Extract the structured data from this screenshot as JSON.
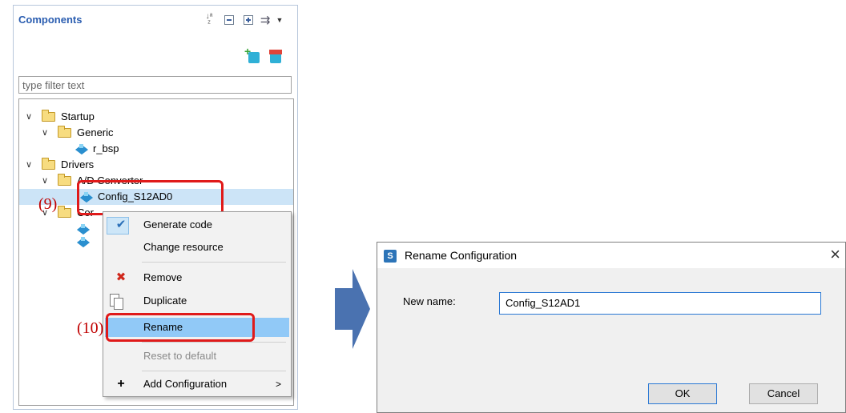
{
  "components": {
    "title": "Components",
    "filter_placeholder": "type filter text",
    "tree": {
      "startup": "Startup",
      "generic": "Generic",
      "r_bsp": "r_bsp",
      "drivers": "Drivers",
      "ad_converter": "A/D Converter",
      "config_s12ad0": "Config_S12AD0",
      "partial_folder": "Cor"
    }
  },
  "context_menu": {
    "items": [
      {
        "label": "Generate code"
      },
      {
        "label": "Change resource"
      },
      {
        "label": "Remove"
      },
      {
        "label": "Duplicate"
      },
      {
        "label": "Rename"
      },
      {
        "label": "Reset to default"
      },
      {
        "label": "Add Configuration"
      }
    ],
    "submenu_arrow": ">"
  },
  "annotations": {
    "step9": "(9)",
    "step10": "(10)"
  },
  "dialog": {
    "title": "Rename Configuration",
    "close": "×",
    "app_icon_letter": "S",
    "new_name_label": "New name:",
    "new_name_value": "Config_S12AD1",
    "ok_label": "OK",
    "cancel_label": "Cancel"
  },
  "colors": {
    "accent_title": "#2a5db0",
    "selection": "#cce4f7",
    "menu_highlight": "#91c9f7",
    "annotation_red": "#e01a1a",
    "arrow_blue": "#4a72b0"
  },
  "icons": {
    "sort": "sort-alpha-icon",
    "collapse": "collapse-all-icon",
    "expand": "expand-all-icon",
    "sync": "sync-icon",
    "add_component": "add-component-icon",
    "remove_component": "remove-component-icon"
  }
}
